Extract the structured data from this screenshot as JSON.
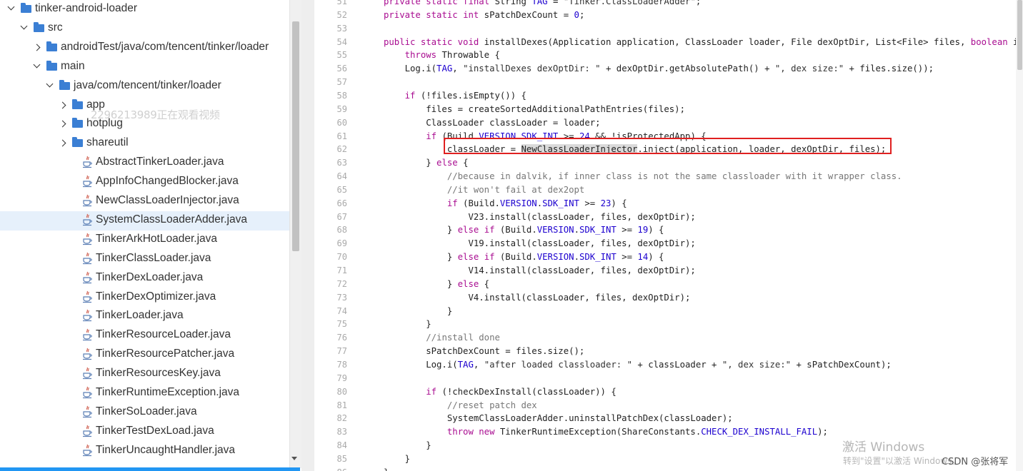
{
  "file_tree": {
    "items": [
      {
        "label": "tinker-android-loader",
        "kind": "folder",
        "depth": 0,
        "expanded": true,
        "selected": false
      },
      {
        "label": "src",
        "kind": "folder",
        "depth": 1,
        "expanded": true,
        "selected": false
      },
      {
        "label": "androidTest/java/com/tencent/tinker/loader",
        "kind": "folder",
        "depth": 2,
        "expanded": false,
        "selected": false
      },
      {
        "label": "main",
        "kind": "folder",
        "depth": 2,
        "expanded": true,
        "selected": false
      },
      {
        "label": "java/com/tencent/tinker/loader",
        "kind": "folder",
        "depth": 3,
        "expanded": true,
        "selected": false
      },
      {
        "label": "app",
        "kind": "folder",
        "depth": 4,
        "expanded": false,
        "selected": false
      },
      {
        "label": "hotplug",
        "kind": "folder",
        "depth": 4,
        "expanded": false,
        "selected": false
      },
      {
        "label": "shareutil",
        "kind": "folder",
        "depth": 4,
        "expanded": false,
        "selected": false
      },
      {
        "label": "AbstractTinkerLoader.java",
        "kind": "file",
        "depth": 4,
        "selected": false
      },
      {
        "label": "AppInfoChangedBlocker.java",
        "kind": "file",
        "depth": 4,
        "selected": false
      },
      {
        "label": "NewClassLoaderInjector.java",
        "kind": "file",
        "depth": 4,
        "selected": false
      },
      {
        "label": "SystemClassLoaderAdder.java",
        "kind": "file",
        "depth": 4,
        "selected": true
      },
      {
        "label": "TinkerArkHotLoader.java",
        "kind": "file",
        "depth": 4,
        "selected": false
      },
      {
        "label": "TinkerClassLoader.java",
        "kind": "file",
        "depth": 4,
        "selected": false
      },
      {
        "label": "TinkerDexLoader.java",
        "kind": "file",
        "depth": 4,
        "selected": false
      },
      {
        "label": "TinkerDexOptimizer.java",
        "kind": "file",
        "depth": 4,
        "selected": false
      },
      {
        "label": "TinkerLoader.java",
        "kind": "file",
        "depth": 4,
        "selected": false
      },
      {
        "label": "TinkerResourceLoader.java",
        "kind": "file",
        "depth": 4,
        "selected": false
      },
      {
        "label": "TinkerResourcePatcher.java",
        "kind": "file",
        "depth": 4,
        "selected": false
      },
      {
        "label": "TinkerResourcesKey.java",
        "kind": "file",
        "depth": 4,
        "selected": false
      },
      {
        "label": "TinkerRuntimeException.java",
        "kind": "file",
        "depth": 4,
        "selected": false
      },
      {
        "label": "TinkerSoLoader.java",
        "kind": "file",
        "depth": 4,
        "selected": false
      },
      {
        "label": "TinkerTestDexLoad.java",
        "kind": "file",
        "depth": 4,
        "selected": false
      },
      {
        "label": "TinkerUncaughtHandler.java",
        "kind": "file",
        "depth": 4,
        "selected": false
      }
    ],
    "viewer_watermark": "2296213989正在观看视频"
  },
  "code": {
    "lines": [
      {
        "n": "51",
        "text": "private static final String TAG = \"Tinker.ClassLoaderAdder\";"
      },
      {
        "n": "52",
        "text": "private static int sPatchDexCount = 0;"
      },
      {
        "n": "53",
        "text": ""
      },
      {
        "n": "54",
        "text": "public static void installDexes(Application application, ClassLoader loader, File dexOptDir, List<File> files, boolean i"
      },
      {
        "n": "55",
        "text": "    throws Throwable {"
      },
      {
        "n": "56",
        "text": "    Log.i(TAG, \"installDexes dexOptDir: \" + dexOptDir.getAbsolutePath() + \", dex size:\" + files.size());"
      },
      {
        "n": "57",
        "text": ""
      },
      {
        "n": "58",
        "text": "    if (!files.isEmpty()) {"
      },
      {
        "n": "59",
        "text": "        files = createSortedAdditionalPathEntries(files);"
      },
      {
        "n": "60",
        "text": "        ClassLoader classLoader = loader;"
      },
      {
        "n": "61",
        "text": "        if (Build.VERSION.SDK_INT >= 24 && !isProtectedApp) {"
      },
      {
        "n": "62",
        "text": "            classLoader = NewClassLoaderInjector.inject(application, loader, dexOptDir, files);"
      },
      {
        "n": "63",
        "text": "        } else {"
      },
      {
        "n": "64",
        "text": "            //because in dalvik, if inner class is not the same classloader with it wrapper class."
      },
      {
        "n": "65",
        "text": "            //it won't fail at dex2opt"
      },
      {
        "n": "66",
        "text": "            if (Build.VERSION.SDK_INT >= 23) {"
      },
      {
        "n": "67",
        "text": "                V23.install(classLoader, files, dexOptDir);"
      },
      {
        "n": "68",
        "text": "            } else if (Build.VERSION.SDK_INT >= 19) {"
      },
      {
        "n": "69",
        "text": "                V19.install(classLoader, files, dexOptDir);"
      },
      {
        "n": "70",
        "text": "            } else if (Build.VERSION.SDK_INT >= 14) {"
      },
      {
        "n": "71",
        "text": "                V14.install(classLoader, files, dexOptDir);"
      },
      {
        "n": "72",
        "text": "            } else {"
      },
      {
        "n": "73",
        "text": "                V4.install(classLoader, files, dexOptDir);"
      },
      {
        "n": "74",
        "text": "            }"
      },
      {
        "n": "75",
        "text": "        }"
      },
      {
        "n": "76",
        "text": "        //install done"
      },
      {
        "n": "77",
        "text": "        sPatchDexCount = files.size();"
      },
      {
        "n": "78",
        "text": "        Log.i(TAG, \"after loaded classloader: \" + classLoader + \", dex size:\" + sPatchDexCount);"
      },
      {
        "n": "79",
        "text": ""
      },
      {
        "n": "80",
        "text": "        if (!checkDexInstall(classLoader)) {"
      },
      {
        "n": "81",
        "text": "            //reset patch dex"
      },
      {
        "n": "82",
        "text": "            SystemClassLoaderAdder.uninstallPatchDex(classLoader);"
      },
      {
        "n": "83",
        "text": "            throw new TinkerRuntimeException(ShareConstants.CHECK_DEX_INSTALL_FAIL);"
      },
      {
        "n": "84",
        "text": "        }"
      },
      {
        "n": "85",
        "text": "    }"
      },
      {
        "n": "86",
        "text": "}"
      }
    ],
    "highlighted_line": "62",
    "selected_token": "NewClassLoaderInjector"
  },
  "overlay": {
    "windows_activate_title": "激活 Windows",
    "windows_activate_sub": "转到\"设置\"以激活 Windows。",
    "csdn_mark": "CSDN @张将军"
  },
  "colors": {
    "keyword": "#a90d91",
    "constant": "#1c00cf",
    "highlight_box": "#e02020",
    "folder": "#3b7fd4",
    "selection": "#e6f0fb",
    "accent_bar": "#2196f3"
  }
}
